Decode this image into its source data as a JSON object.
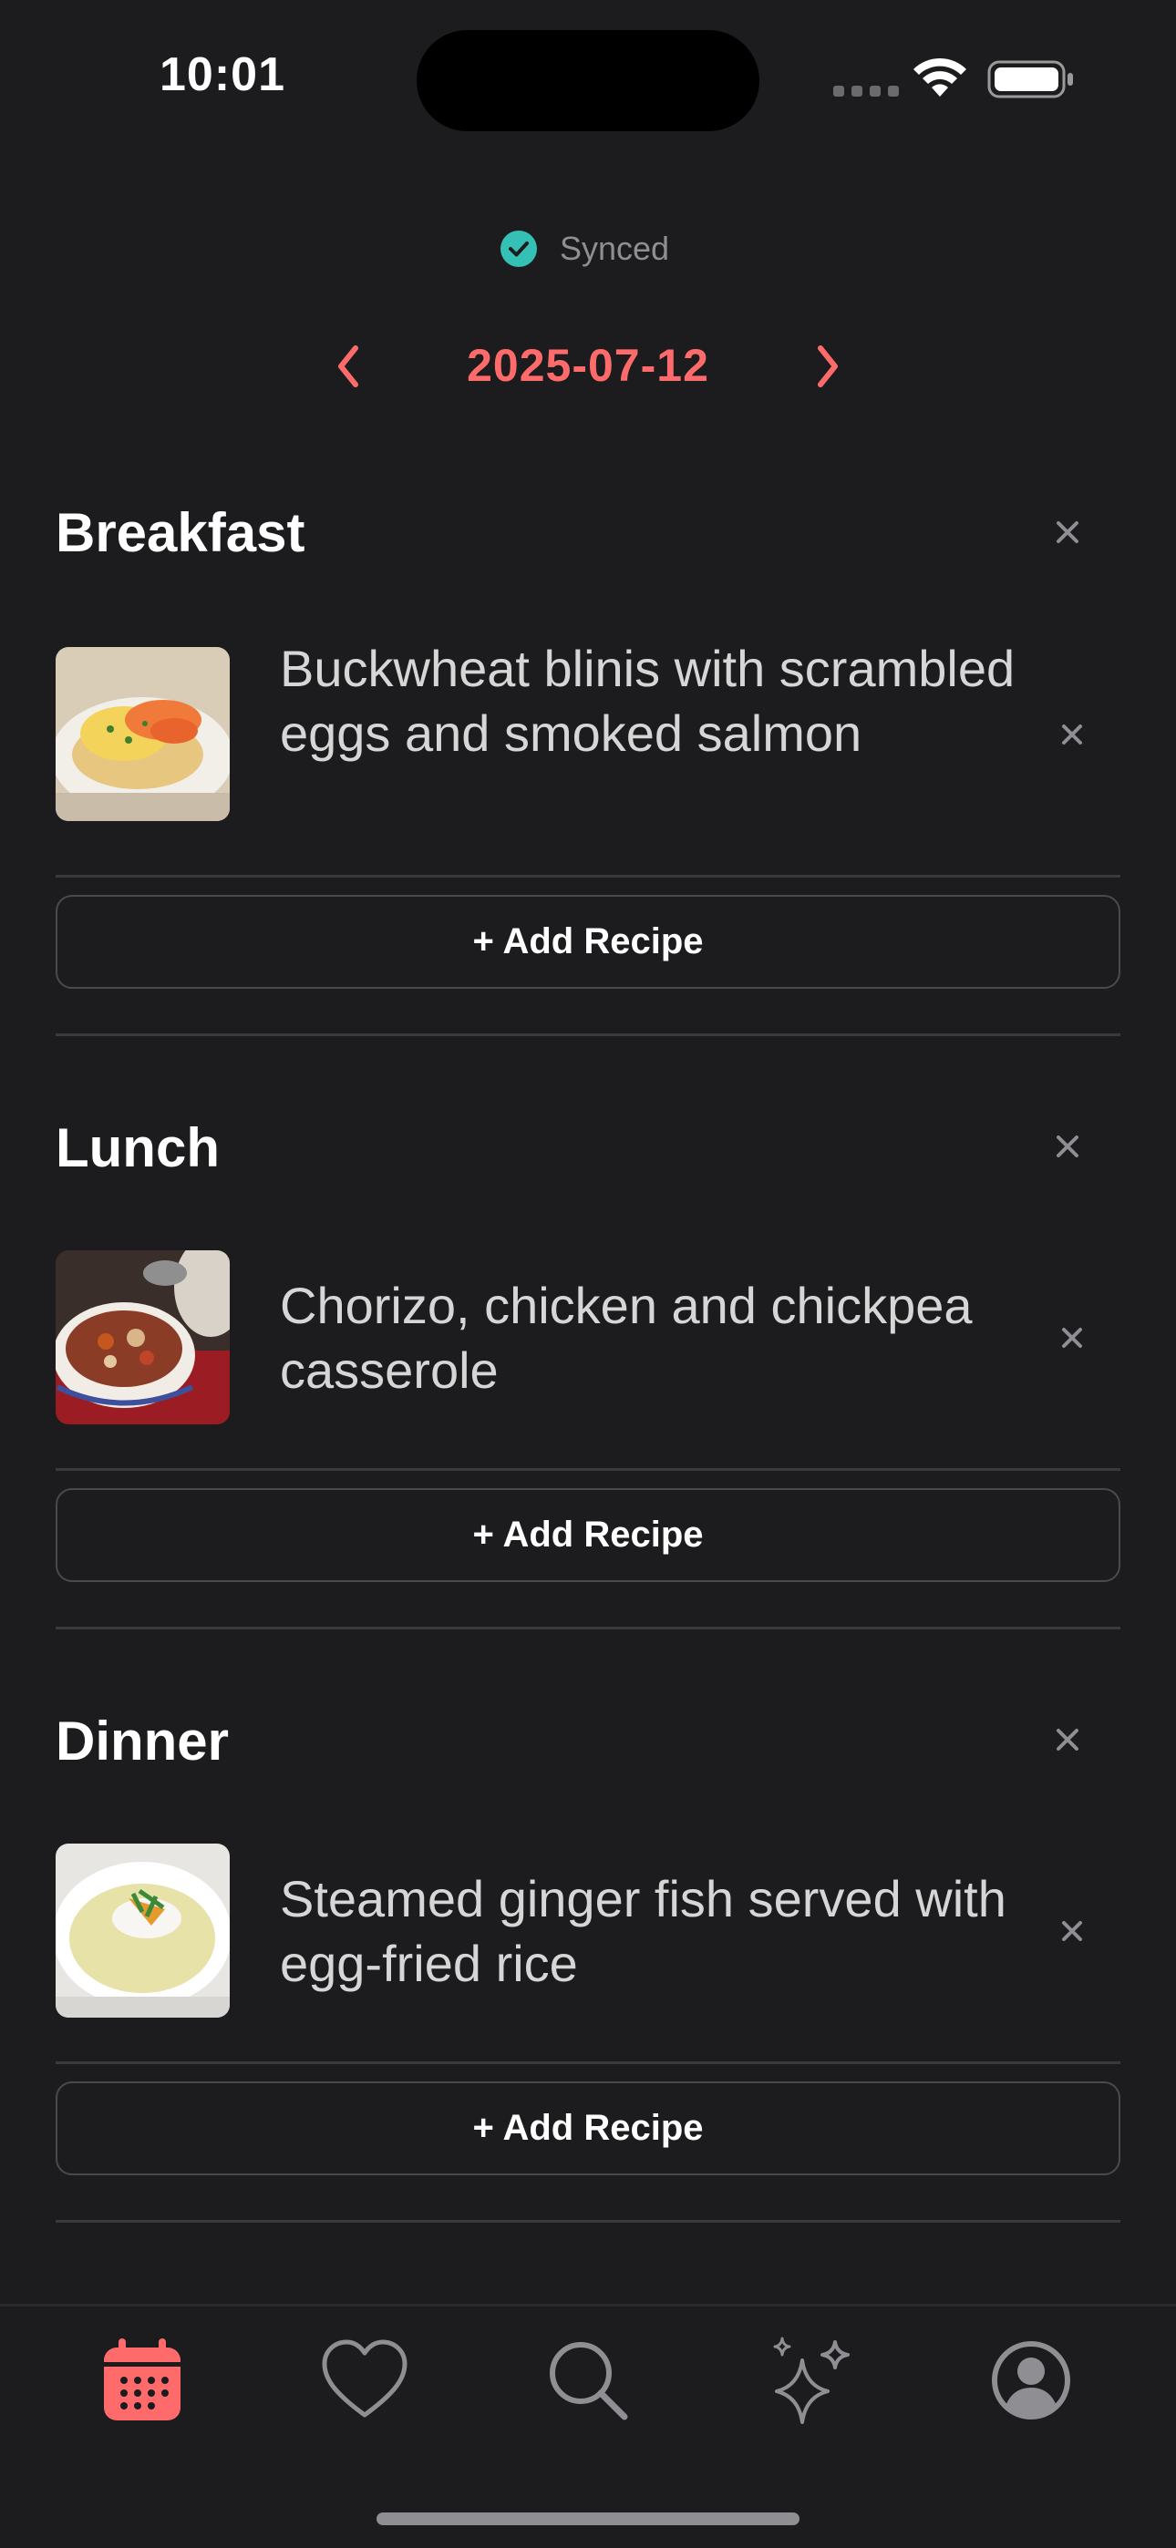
{
  "status_bar": {
    "time": "10:01"
  },
  "sync": {
    "label": "Synced",
    "icon": "check-circle-icon",
    "color": "#34c0b4"
  },
  "date_nav": {
    "date": "2025-07-12",
    "prev_icon": "chevron-left-icon",
    "next_icon": "chevron-right-icon",
    "accent": "#ff6b6b"
  },
  "sections": [
    {
      "title": "Breakfast",
      "recipe": "Buckwheat blinis with scrambled eggs and smoked salmon",
      "add_label": "+ Add Recipe"
    },
    {
      "title": "Lunch",
      "recipe": "Chorizo, chicken and chickpea casserole",
      "add_label": "+ Add Recipe"
    },
    {
      "title": "Dinner",
      "recipe": "Steamed ginger fish served with egg-fried rice",
      "add_label": "+ Add Recipe"
    }
  ],
  "tabbar": {
    "items": [
      {
        "icon": "calendar-icon",
        "active": true
      },
      {
        "icon": "heart-icon",
        "active": false
      },
      {
        "icon": "search-icon",
        "active": false
      },
      {
        "icon": "sparkles-icon",
        "active": false
      },
      {
        "icon": "profile-icon",
        "active": false
      }
    ]
  }
}
